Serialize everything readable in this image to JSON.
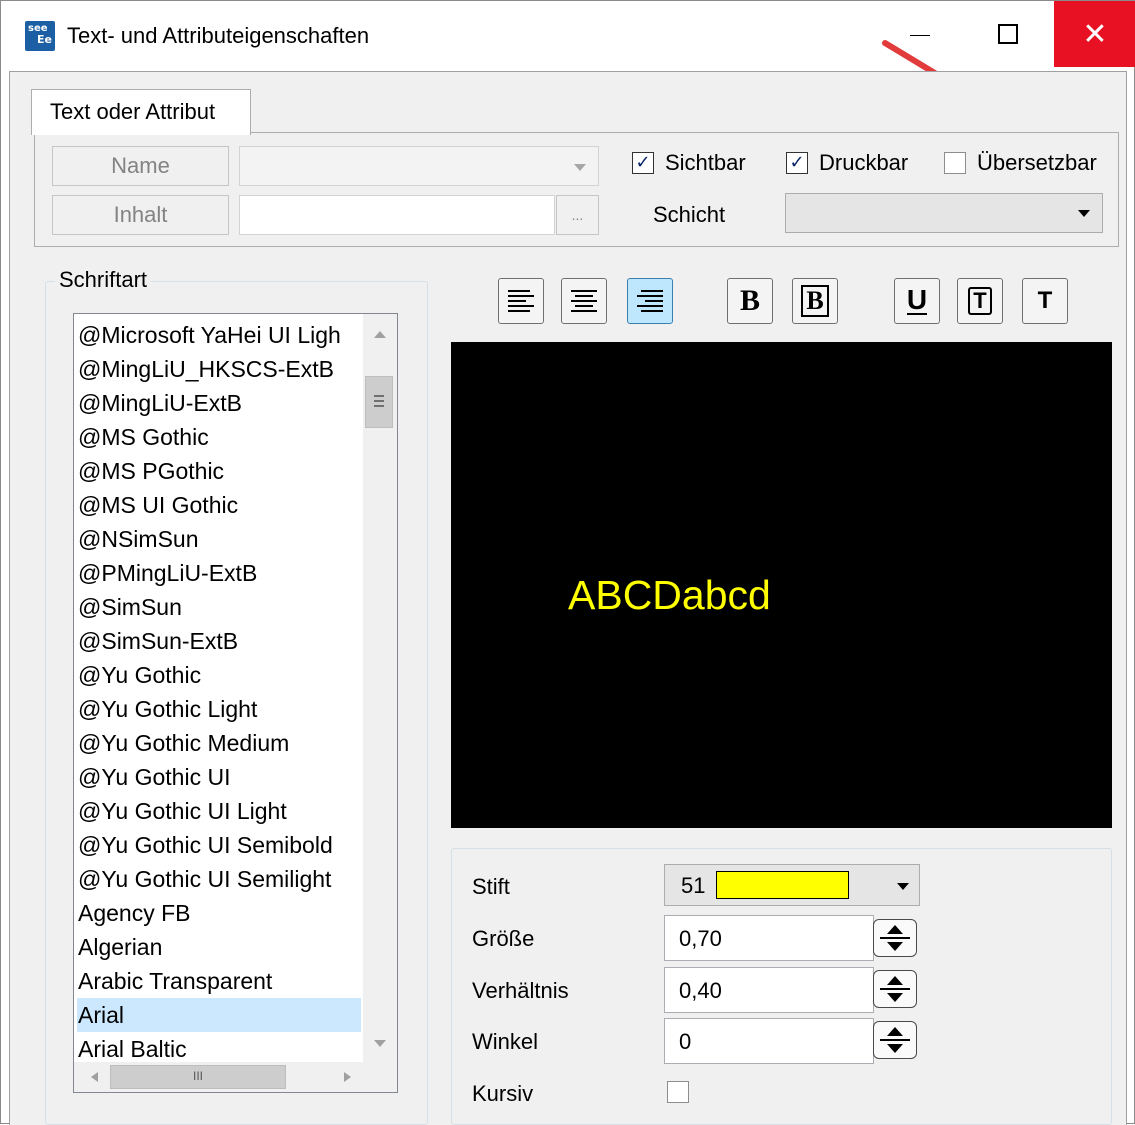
{
  "window": {
    "title": "Text- und Attributeigenschaften",
    "app_icon_line1": "see",
    "app_icon_line2": "Ee",
    "close_glyph": "✕"
  },
  "tab": {
    "label": "Text oder Attribut"
  },
  "attribute": {
    "name_button": "Name",
    "content_button": "Inhalt",
    "content_browse": "...",
    "visible_label": "Sichtbar",
    "visible_checked": true,
    "printable_label": "Druckbar",
    "printable_checked": true,
    "translatable_label": "Übersetzbar",
    "translatable_checked": false,
    "layer_label": "Schicht",
    "check_glyph": "✓"
  },
  "font": {
    "group_title": "Schriftart",
    "items": [
      "@Microsoft YaHei UI Ligh",
      "@MingLiU_HKSCS-ExtB",
      "@MingLiU-ExtB",
      "@MS Gothic",
      "@MS PGothic",
      "@MS UI Gothic",
      "@NSimSun",
      "@PMingLiU-ExtB",
      "@SimSun",
      "@SimSun-ExtB",
      "@Yu Gothic",
      "@Yu Gothic Light",
      "@Yu Gothic Medium",
      "@Yu Gothic UI",
      "@Yu Gothic UI Light",
      "@Yu Gothic UI Semibold",
      "@Yu Gothic UI Semilight",
      "Agency FB",
      "Algerian",
      "Arabic Transparent",
      "Arial",
      "Arial Baltic"
    ],
    "selected": "Arial",
    "hscroll_grip": "III"
  },
  "toolbar": {
    "bold_label": "B",
    "bold_outline_label": "B",
    "underline_label": "U",
    "framed_label": "T",
    "plain_label": "T"
  },
  "preview": {
    "text": "ABCDabcd",
    "text_color": "#ffff00"
  },
  "props": {
    "pen_label": "Stift",
    "pen_value": "51",
    "pen_color": "#ffff00",
    "size_label": "Größe",
    "size_value": "0,70",
    "ratio_label": "Verhältnis",
    "ratio_value": "0,40",
    "angle_label": "Winkel",
    "angle_value": "0",
    "italic_label": "Kursiv",
    "italic_checked": false
  }
}
